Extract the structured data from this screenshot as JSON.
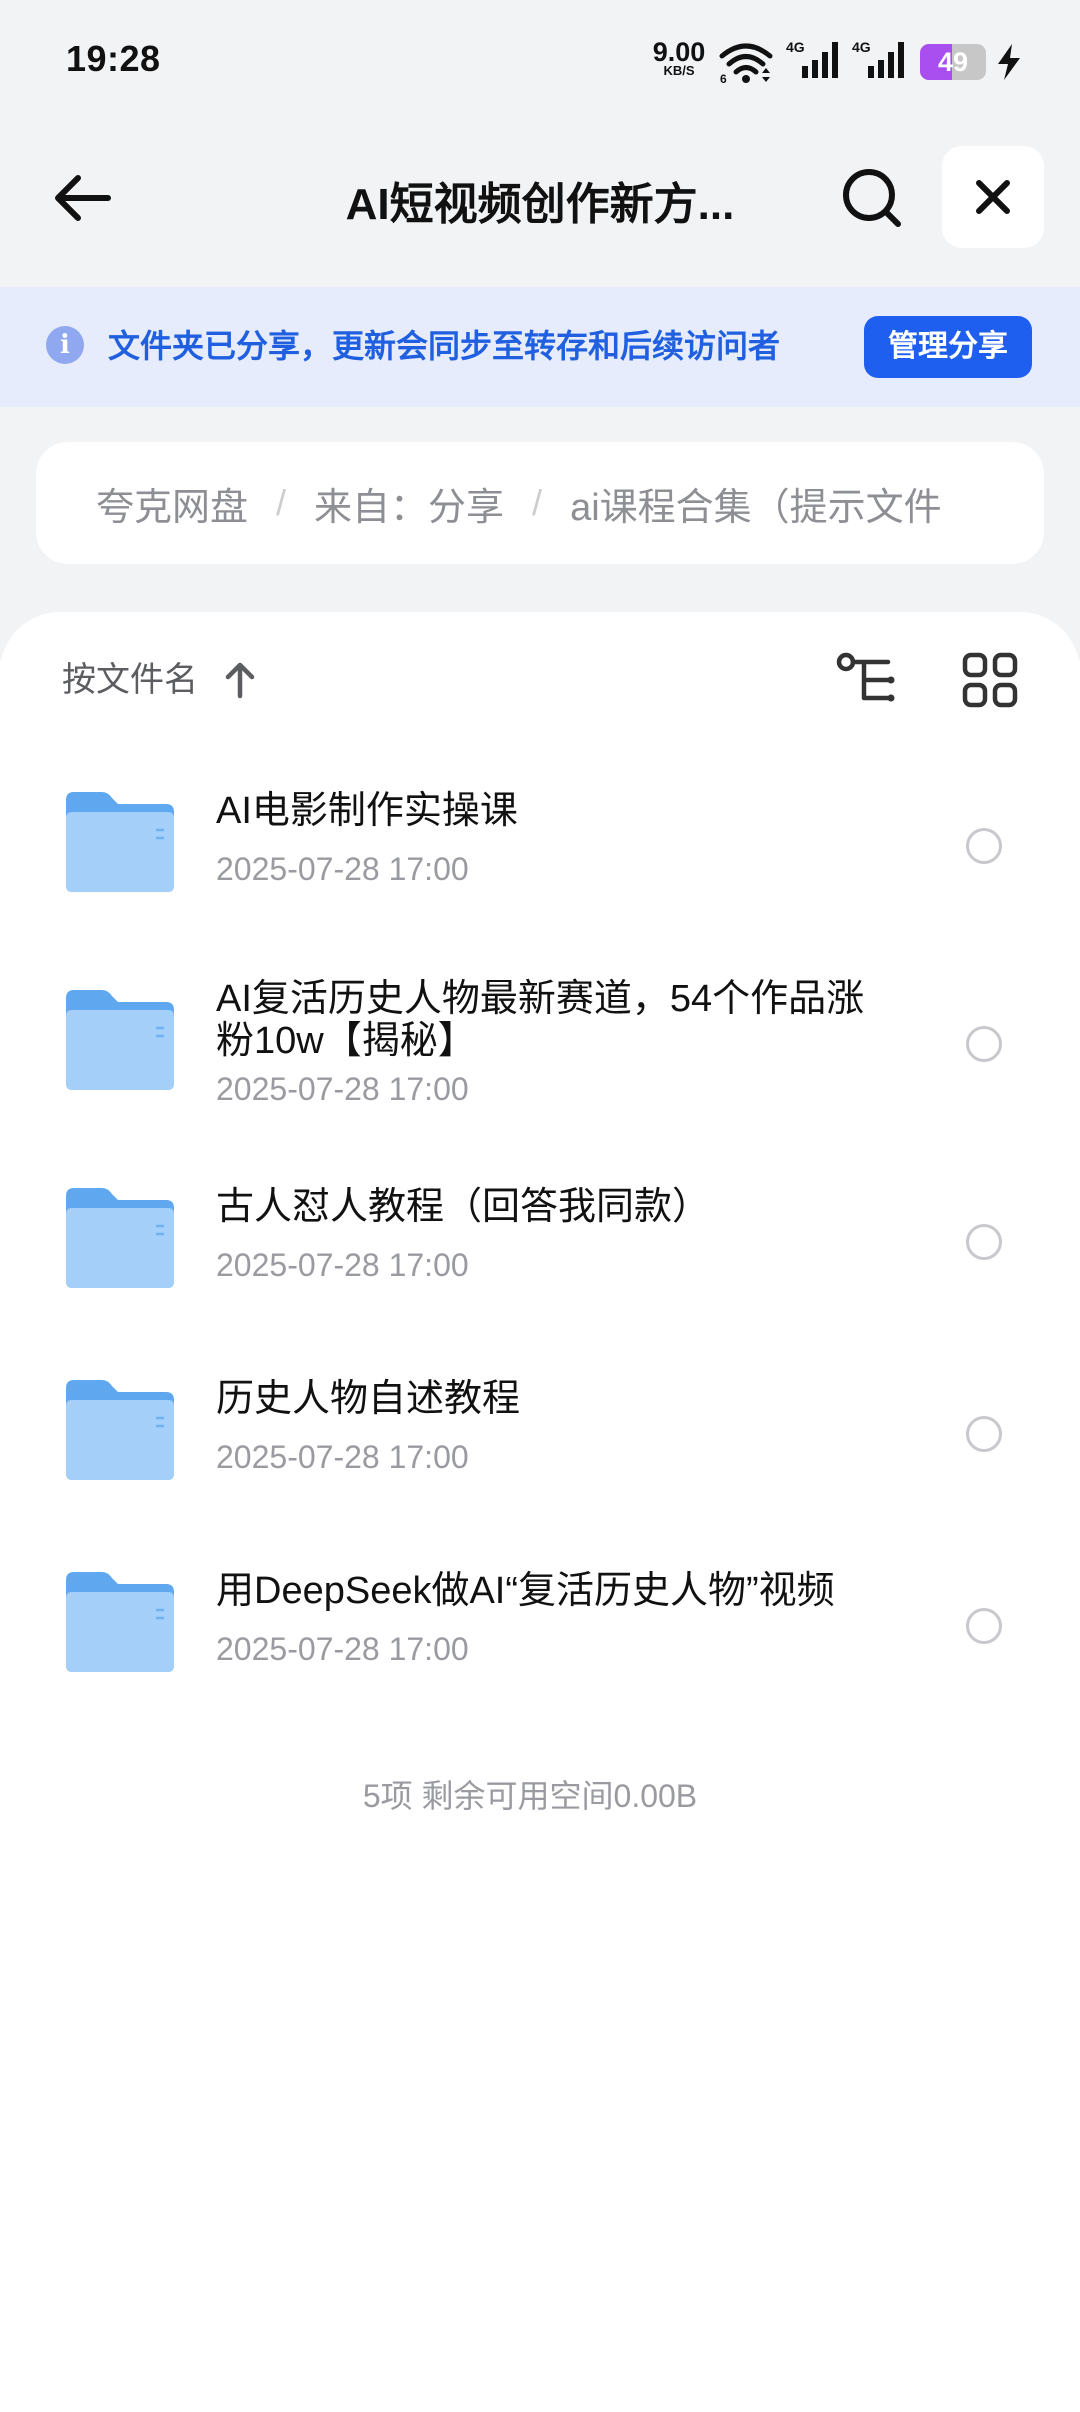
{
  "status_bar": {
    "time": "19:28",
    "net_speed": "9.00",
    "net_speed_unit": "KB/S",
    "signal_1_label": "4G",
    "signal_2_label": "4G",
    "battery_level": "49"
  },
  "header": {
    "title": "AI短视频创作新方..."
  },
  "share_notice": {
    "text": "文件夹已分享，更新会同步至转存和后续访问者",
    "button_label": "管理分享"
  },
  "breadcrumb": {
    "items": [
      "夸克网盘",
      "来自：分享",
      "ai课程合集（提示文件"
    ],
    "separator": "/"
  },
  "toolbar": {
    "sort_label": "按文件名"
  },
  "files": [
    {
      "name": "AI电影制作实操课",
      "date": "2025-07-28 17:00"
    },
    {
      "name": "AI复活历史人物最新赛道，54个作品涨粉10w【揭秘】",
      "date": "2025-07-28 17:00"
    },
    {
      "name": "古人怼人教程（回答我同款）",
      "date": "2025-07-28 17:00"
    },
    {
      "name": "历史人物自述教程",
      "date": "2025-07-28 17:00"
    },
    {
      "name": "用DeepSeek做AI“复活历史人物”视频",
      "date": "2025-07-28 17:00"
    }
  ],
  "footer": {
    "summary": "5项 剩余可用空间0.00B"
  },
  "colors": {
    "accent": "#1e5fef",
    "notice_bg": "#e6ecfb",
    "folder": "#6cb4f5",
    "battery": "#a94ff0"
  },
  "icons": [
    "back-arrow-icon",
    "search-icon",
    "close-icon",
    "info-icon",
    "sort-up-arrow-icon",
    "tree-view-icon",
    "grid-view-icon",
    "folder-icon",
    "wifi-icon",
    "signal-icon",
    "charging-icon"
  ]
}
